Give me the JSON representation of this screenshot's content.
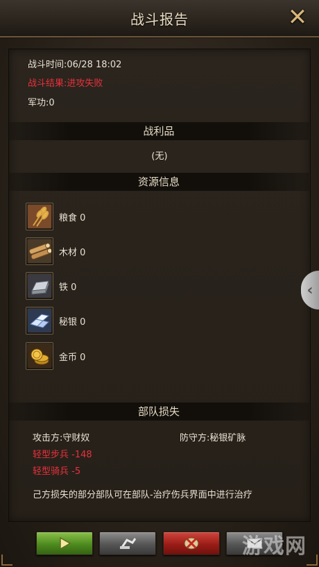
{
  "header": {
    "title": "战斗报告",
    "close_icon": "close-icon"
  },
  "report": {
    "time": "战斗时间:06/28 18:02",
    "result": "战斗结果:进攻失败",
    "merit": "军功:0"
  },
  "spoils": {
    "header": "战利品",
    "value": "(无)"
  },
  "resources": {
    "header": "资源信息",
    "items": [
      {
        "label": "粮食 0",
        "icon": "wheat-icon"
      },
      {
        "label": "木材 0",
        "icon": "wood-icon"
      },
      {
        "label": "铁 0",
        "icon": "iron-ingot-icon"
      },
      {
        "label": "秘银 0",
        "icon": "mithril-icon"
      },
      {
        "label": "金币 0",
        "icon": "gold-coin-icon"
      }
    ]
  },
  "troops": {
    "header": "部队损失",
    "attacker": "攻击方:守财奴",
    "defender": "防守方:秘银矿脉",
    "losses": [
      "轻型步兵 -148",
      "轻型骑兵 -5"
    ],
    "note": "己方损失的部分部队可在部队-治疗伤兵界面中进行治疗"
  },
  "watermark": "游戏网",
  "colors": {
    "loss_red": "#e8313b",
    "title_gold": "#d8b57a"
  }
}
